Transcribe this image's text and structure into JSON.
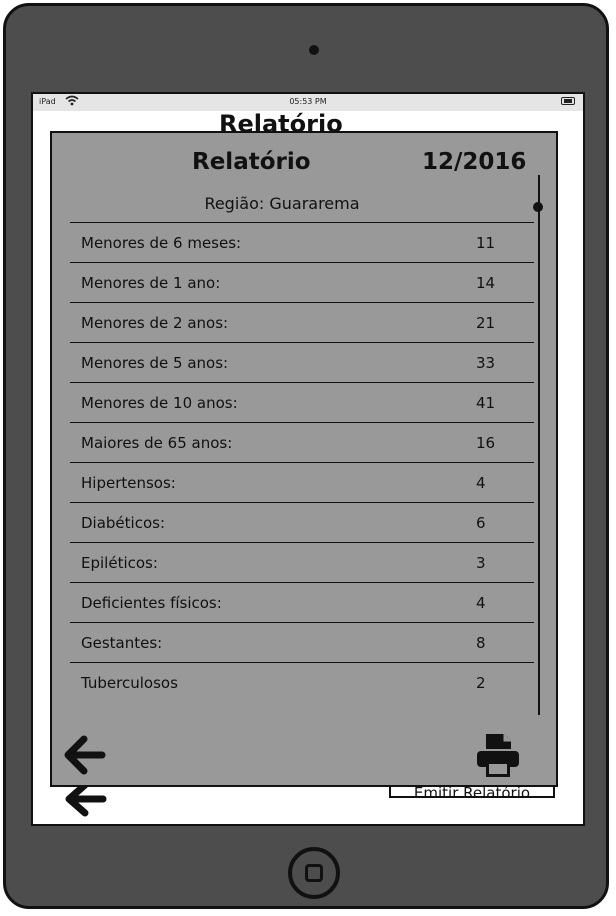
{
  "status_bar": {
    "carrier": "iPad",
    "time": "05:53 PM"
  },
  "background": {
    "title": "Relatório",
    "button_label": "Emitir Relatório"
  },
  "modal": {
    "title": "Relatório",
    "date": "12/2016",
    "region": "Região: Guararema",
    "rows": [
      {
        "label": "Menores de 6 meses:",
        "value": "11"
      },
      {
        "label": "Menores de 1 ano:",
        "value": "14"
      },
      {
        "label": "Menores de 2 anos:",
        "value": "21"
      },
      {
        "label": "Menores de 5 anos:",
        "value": "33"
      },
      {
        "label": "Menores de 10 anos:",
        "value": "41"
      },
      {
        "label": "Maiores de 65 anos:",
        "value": "16"
      },
      {
        "label": "Hipertensos:",
        "value": "4"
      },
      {
        "label": "Diabéticos:",
        "value": "6"
      },
      {
        "label": "Epiléticos:",
        "value": "3"
      },
      {
        "label": "Deficientes físicos:",
        "value": "4"
      },
      {
        "label": "Gestantes:",
        "value": "8"
      },
      {
        "label": "Tuberculosos",
        "value": "2"
      }
    ],
    "icons": {
      "back": "arrow-left-icon",
      "print": "printer-icon"
    }
  },
  "colors": {
    "device": "#4d4d4d",
    "modal": "#999999",
    "statusbar": "#e5e5e5"
  }
}
